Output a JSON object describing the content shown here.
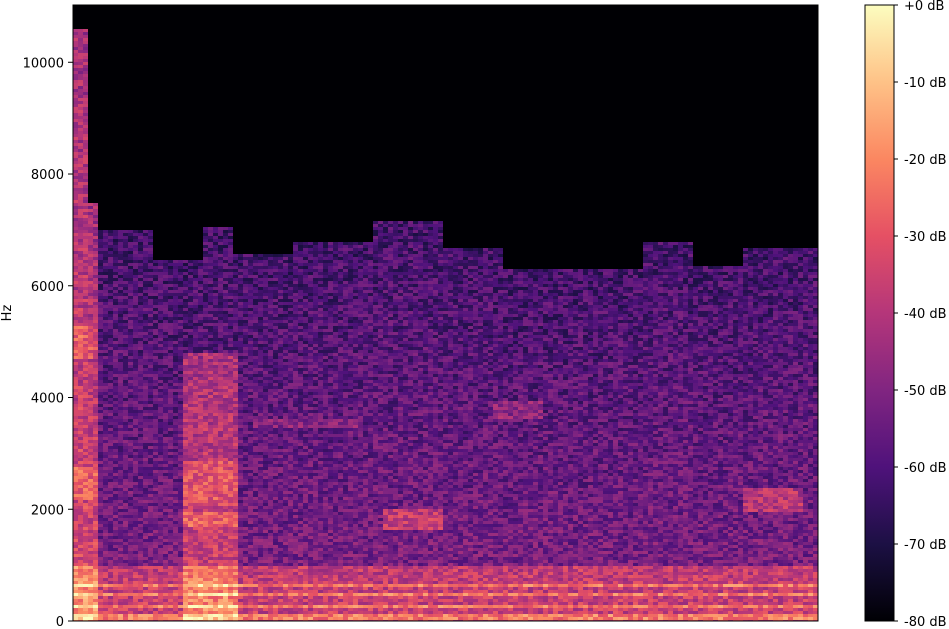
{
  "chart_data": {
    "type": "heatmap",
    "title": "",
    "xlabel": "",
    "ylabel": "Hz",
    "ylim": [
      0,
      11025
    ],
    "y_ticks": [
      0,
      2000,
      4000,
      6000,
      8000,
      10000
    ],
    "y_tick_labels": [
      "0",
      "2000",
      "4000",
      "6000",
      "8000",
      "10000"
    ],
    "colormap": "magma",
    "colorbar": {
      "range": [
        -80,
        0
      ],
      "ticks": [
        0,
        -10,
        -20,
        -30,
        -40,
        -50,
        -60,
        -70,
        -80
      ],
      "tick_labels": [
        "+0 dB",
        "-10 dB",
        "-20 dB",
        "-30 dB",
        "-40 dB",
        "-50 dB",
        "-60 dB",
        "-70 dB",
        "-80 dB"
      ]
    },
    "energy_regions_hz_db": [
      {
        "freq": 100,
        "level_db": -22
      },
      {
        "freq": 300,
        "level_db": -25
      },
      {
        "freq": 500,
        "level_db": -28
      },
      {
        "freq": 650,
        "level_db": -30
      },
      {
        "freq": 1800,
        "level_db": -35
      },
      {
        "freq": 2500,
        "level_db": -32
      },
      {
        "freq": 5000,
        "level_db": -35
      },
      {
        "freq": 3800,
        "level_db": -50
      },
      {
        "freq": 7000,
        "level_db": -70
      },
      {
        "freq": 9000,
        "level_db": -80
      }
    ],
    "grid": false
  },
  "colors": {
    "background": "#ffffff",
    "axis": "#000000",
    "empty": "#000004"
  }
}
